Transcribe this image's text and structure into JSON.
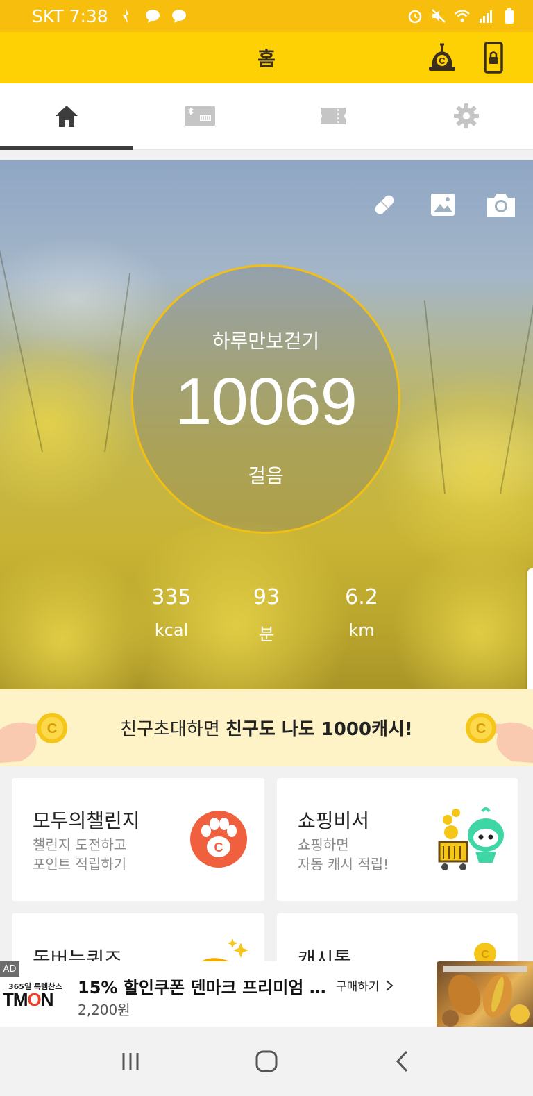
{
  "status_bar": {
    "carrier_time": "SKT 7:38",
    "left_icons": [
      "activity-icon",
      "talk-icon",
      "talk-icon"
    ],
    "right_icons": [
      "alarm-icon",
      "mute-icon",
      "wifi-icon",
      "signal-icon",
      "battery-icon"
    ]
  },
  "header": {
    "title": "홈",
    "buttons": [
      "cash-coin-icon",
      "lock-screen-icon"
    ],
    "colors": {
      "status": "#f7be0e",
      "bar": "#fdd103"
    }
  },
  "tabs": [
    {
      "id": "home",
      "icon": "home-icon",
      "active": true
    },
    {
      "id": "coupon",
      "icon": "gift-card-icon",
      "active": false
    },
    {
      "id": "ticket",
      "icon": "ticket-icon",
      "active": false
    },
    {
      "id": "settings",
      "icon": "gear-icon",
      "active": false
    }
  ],
  "hero": {
    "tools": [
      "pill-icon",
      "gallery-icon",
      "camera-icon"
    ],
    "ring_label": "하루만보걷기",
    "steps": "10069",
    "steps_unit": "걸음",
    "stats": [
      {
        "value": "335",
        "unit": "kcal"
      },
      {
        "value": "93",
        "unit": "분"
      },
      {
        "value": "6.2",
        "unit": "km"
      }
    ],
    "ring_color": "#f2c014"
  },
  "invite": {
    "text_plain": "친구초대하면 ",
    "text_bold": "친구도 나도 1000캐시!"
  },
  "cards": [
    {
      "title": "모두의챌린지",
      "sub1": "챌린지 도전하고",
      "sub2": "포인트 적립하기"
    },
    {
      "title": "쇼핑비서",
      "sub1": "쇼핑하면",
      "sub2": "자동 캐시 적립!"
    },
    {
      "title": "돈버는퀴즈"
    },
    {
      "title": "캐시톡"
    }
  ],
  "ad": {
    "tag": "AD",
    "brand_sub": "365일 특템찬스",
    "brand_pre": "TM",
    "brand_o": "O",
    "brand_post": "N",
    "title": "15% 할인쿠폰 덴마크 프리미엄 …",
    "price": "2,200원",
    "cta": "구매하기"
  },
  "nav": [
    "recent-apps-icon",
    "home-button-icon",
    "back-icon"
  ]
}
